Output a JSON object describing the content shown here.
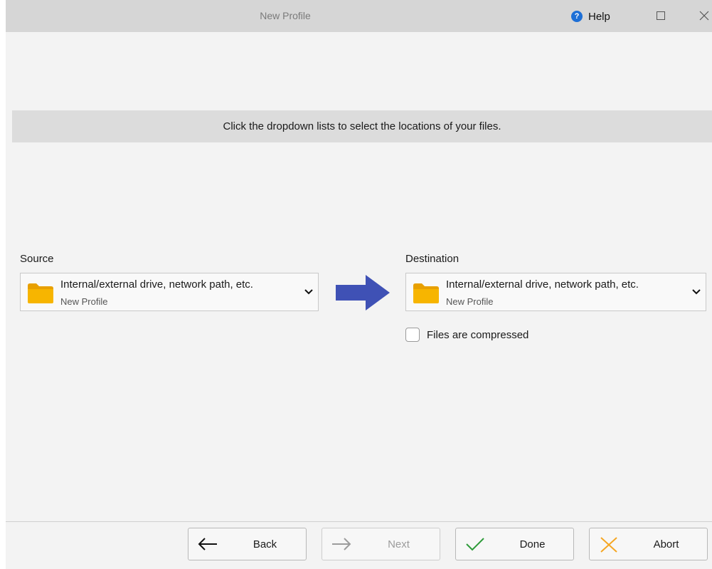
{
  "window": {
    "title": "New Profile",
    "help_label": "Help",
    "help_icon_glyph": "?"
  },
  "instruction": "Click the dropdown lists to select the locations of your files.",
  "source": {
    "label": "Source",
    "main": "Internal/external drive, network path, etc.",
    "sub": "New Profile",
    "icon": "folder-icon"
  },
  "destination": {
    "label": "Destination",
    "main": "Internal/external drive, network path, etc.",
    "sub": "New Profile",
    "icon": "folder-icon"
  },
  "compressed": {
    "label": "Files are compressed",
    "checked": false
  },
  "buttons": {
    "back": "Back",
    "next": "Next",
    "done": "Done",
    "abort": "Abort"
  },
  "colors": {
    "accent_arrow": "#3f51b5",
    "folder": "#f7b500",
    "help_icon": "#1d6fd6",
    "done_check": "#2e9b3a",
    "abort_x": "#f5a623"
  }
}
